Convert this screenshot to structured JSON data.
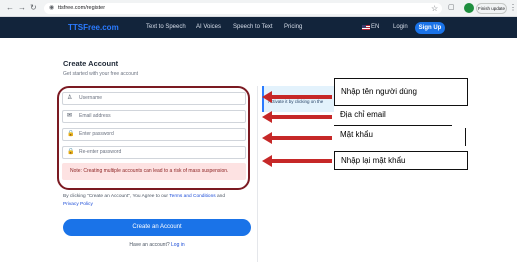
{
  "browser": {
    "back_icon": "back-arrow-icon",
    "forward_icon": "forward-arrow-icon",
    "reload_icon": "reload-icon",
    "url": "ttsfree.com/register",
    "update_label": "Finish update"
  },
  "header": {
    "logo": "TTSFree.com",
    "nav": [
      "Text to Speech",
      "AI Voices",
      "Speech to Text",
      "Pricing"
    ],
    "language": "EN",
    "login": "Login",
    "signup": "Sign Up",
    "background_color": "#12243b",
    "accent_color": "#1a73e8"
  },
  "form": {
    "title": "Create Account",
    "subtitle": "Get started with your free account",
    "fields": [
      {
        "placeholder": "Username",
        "icon": "user-icon"
      },
      {
        "placeholder": "Email address",
        "icon": "envelope-icon"
      },
      {
        "placeholder": "Enter password",
        "icon": "lock-icon"
      },
      {
        "placeholder": "Re-enter password",
        "icon": "lock-icon"
      }
    ],
    "note": "Note: Creating multiple accounts can lead to a risk of mass suspension.",
    "terms_prefix": "By clicking \"Create an Account\", You Agree to our",
    "terms_link": "Terms and Conditions",
    "terms_and": "and",
    "privacy_link": "Privacy Policy",
    "create_button": "Create an Account",
    "have_account": "Have an account?",
    "login_link": "Log in"
  },
  "side_panel": {
    "text": "Activate it by clicking on the"
  },
  "annotations": {
    "labels": [
      "Nhập tên người dùng",
      "Địa chỉ email",
      "Mật khẩu",
      "Nhập lại mật khẩu"
    ],
    "arrow_color": "#c62828",
    "outline_color": "#7b1a22"
  }
}
